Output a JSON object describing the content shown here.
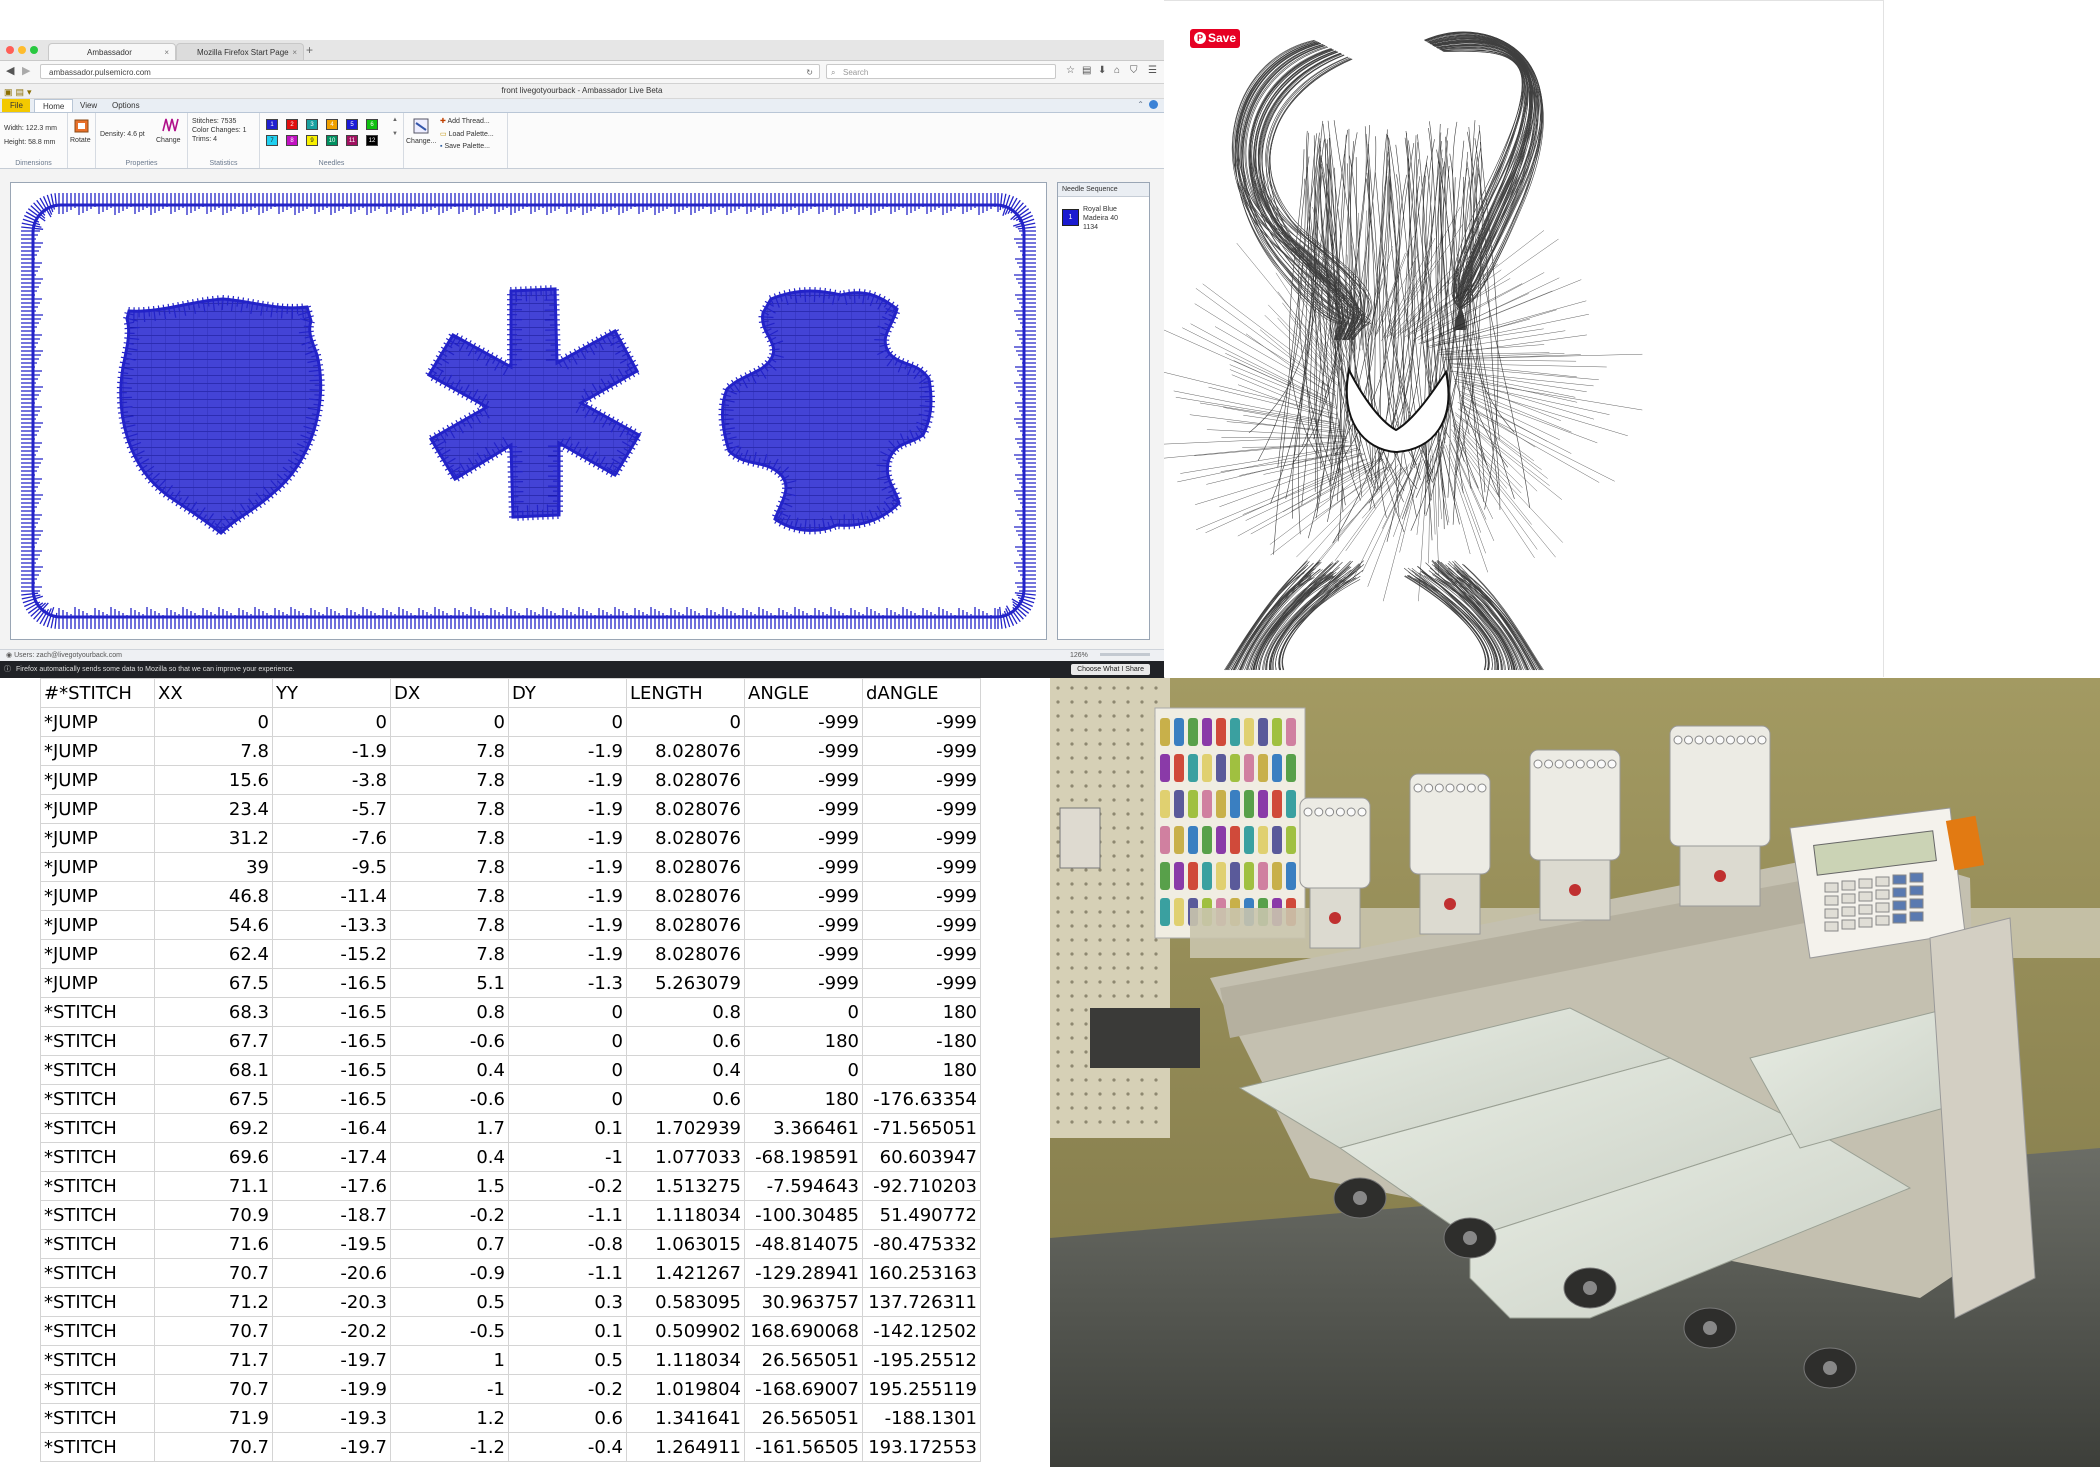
{
  "browser": {
    "tabs": [
      {
        "label": "Ambassador",
        "active": true
      },
      {
        "label": "Mozilla Firefox Start Page",
        "active": false
      }
    ],
    "url": "ambassador.pulsemicro.com",
    "search_placeholder": "Search",
    "window_title": "front livegotyourback - Ambassador Live Beta",
    "ribbon_tabs": [
      "File",
      "Home",
      "View",
      "Options"
    ],
    "ribbon_active_tab": "Home",
    "dimensions": {
      "width": "Width: 122.3 mm",
      "height": "Height: 58.8 mm",
      "rotate": "Rotate",
      "group": "Dimensions"
    },
    "properties": {
      "density": "Density: 4.6 pt",
      "change": "Change",
      "group": "Properties"
    },
    "statistics": {
      "stitches": "Stitches: 7535",
      "color_changes": "Color Changes: 1",
      "trims": "Trims: 4",
      "group": "Statistics"
    },
    "needles": {
      "group": "Needles",
      "items": [
        {
          "num": "1",
          "color": "#1f1fd0"
        },
        {
          "num": "2",
          "color": "#e01010"
        },
        {
          "num": "3",
          "color": "#19a0a0"
        },
        {
          "num": "4",
          "color": "#f0a000"
        },
        {
          "num": "5",
          "color": "#1a1ad8"
        },
        {
          "num": "6",
          "color": "#10c010"
        },
        {
          "num": "7",
          "color": "#20d0f0"
        },
        {
          "num": "8",
          "color": "#c010c0"
        },
        {
          "num": "9",
          "color": "#f8f000"
        },
        {
          "num": "10",
          "color": "#009060"
        },
        {
          "num": "11",
          "color": "#a01060"
        },
        {
          "num": "12",
          "color": "#000000"
        }
      ],
      "change": "Change..."
    },
    "palette": {
      "add": "Add Thread...",
      "load": "Load Palette...",
      "save": "Save Palette..."
    },
    "needle_sequence": {
      "title": "Needle Sequence",
      "num": "1",
      "lines": [
        "Royal Blue",
        "Madeira 40",
        "1134"
      ]
    },
    "status_text": "Users: zach@livegotyourback.com",
    "zoom": "126%",
    "notification": "Firefox automatically sends some data to Mozilla so that we can improve your experience.",
    "notification_button": "Choose What I Share",
    "stitch_color": "#2323c8"
  },
  "pinterest": {
    "save_label": "Save",
    "save_color": "#e60023"
  },
  "sheet": {
    "headers": [
      "#*STITCH",
      "XX",
      "YY",
      "DX",
      "DY",
      "LENGTH",
      "ANGLE",
      "dANGLE"
    ],
    "rows": [
      [
        "*JUMP",
        "0",
        "0",
        "0",
        "0",
        "0",
        "-999",
        "-999"
      ],
      [
        "*JUMP",
        "7.8",
        "-1.9",
        "7.8",
        "-1.9",
        "8.028076",
        "-999",
        "-999"
      ],
      [
        "*JUMP",
        "15.6",
        "-3.8",
        "7.8",
        "-1.9",
        "8.028076",
        "-999",
        "-999"
      ],
      [
        "*JUMP",
        "23.4",
        "-5.7",
        "7.8",
        "-1.9",
        "8.028076",
        "-999",
        "-999"
      ],
      [
        "*JUMP",
        "31.2",
        "-7.6",
        "7.8",
        "-1.9",
        "8.028076",
        "-999",
        "-999"
      ],
      [
        "*JUMP",
        "39",
        "-9.5",
        "7.8",
        "-1.9",
        "8.028076",
        "-999",
        "-999"
      ],
      [
        "*JUMP",
        "46.8",
        "-11.4",
        "7.8",
        "-1.9",
        "8.028076",
        "-999",
        "-999"
      ],
      [
        "*JUMP",
        "54.6",
        "-13.3",
        "7.8",
        "-1.9",
        "8.028076",
        "-999",
        "-999"
      ],
      [
        "*JUMP",
        "62.4",
        "-15.2",
        "7.8",
        "-1.9",
        "8.028076",
        "-999",
        "-999"
      ],
      [
        "*JUMP",
        "67.5",
        "-16.5",
        "5.1",
        "-1.3",
        "5.263079",
        "-999",
        "-999"
      ],
      [
        "*STITCH",
        "68.3",
        "-16.5",
        "0.8",
        "0",
        "0.8",
        "0",
        "180"
      ],
      [
        "*STITCH",
        "67.7",
        "-16.5",
        "-0.6",
        "0",
        "0.6",
        "180",
        "-180"
      ],
      [
        "*STITCH",
        "68.1",
        "-16.5",
        "0.4",
        "0",
        "0.4",
        "0",
        "180"
      ],
      [
        "*STITCH",
        "67.5",
        "-16.5",
        "-0.6",
        "0",
        "0.6",
        "180",
        "-176.63354"
      ],
      [
        "*STITCH",
        "69.2",
        "-16.4",
        "1.7",
        "0.1",
        "1.702939",
        "3.366461",
        "-71.565051"
      ],
      [
        "*STITCH",
        "69.6",
        "-17.4",
        "0.4",
        "-1",
        "1.077033",
        "-68.198591",
        "60.603947"
      ],
      [
        "*STITCH",
        "71.1",
        "-17.6",
        "1.5",
        "-0.2",
        "1.513275",
        "-7.594643",
        "-92.710203"
      ],
      [
        "*STITCH",
        "70.9",
        "-18.7",
        "-0.2",
        "-1.1",
        "1.118034",
        "-100.30485",
        "51.490772"
      ],
      [
        "*STITCH",
        "71.6",
        "-19.5",
        "0.7",
        "-0.8",
        "1.063015",
        "-48.814075",
        "-80.475332"
      ],
      [
        "*STITCH",
        "70.7",
        "-20.6",
        "-0.9",
        "-1.1",
        "1.421267",
        "-129.28941",
        "160.253163"
      ],
      [
        "*STITCH",
        "71.2",
        "-20.3",
        "0.5",
        "0.3",
        "0.583095",
        "30.963757",
        "137.726311"
      ],
      [
        "*STITCH",
        "70.7",
        "-20.2",
        "-0.5",
        "0.1",
        "0.509902",
        "168.690068",
        "-142.12502"
      ],
      [
        "*STITCH",
        "71.7",
        "-19.7",
        "1",
        "0.5",
        "1.118034",
        "26.565051",
        "-195.25512"
      ],
      [
        "*STITCH",
        "70.7",
        "-19.9",
        "-1",
        "-0.2",
        "1.019804",
        "-168.69007",
        "195.255119"
      ],
      [
        "*STITCH",
        "71.9",
        "-19.3",
        "1.2",
        "0.6",
        "1.341641",
        "26.565051",
        "-188.1301"
      ],
      [
        "*STITCH",
        "70.7",
        "-19.7",
        "-1.2",
        "-0.4",
        "1.264911",
        "-161.56505",
        "193.172553"
      ]
    ]
  }
}
